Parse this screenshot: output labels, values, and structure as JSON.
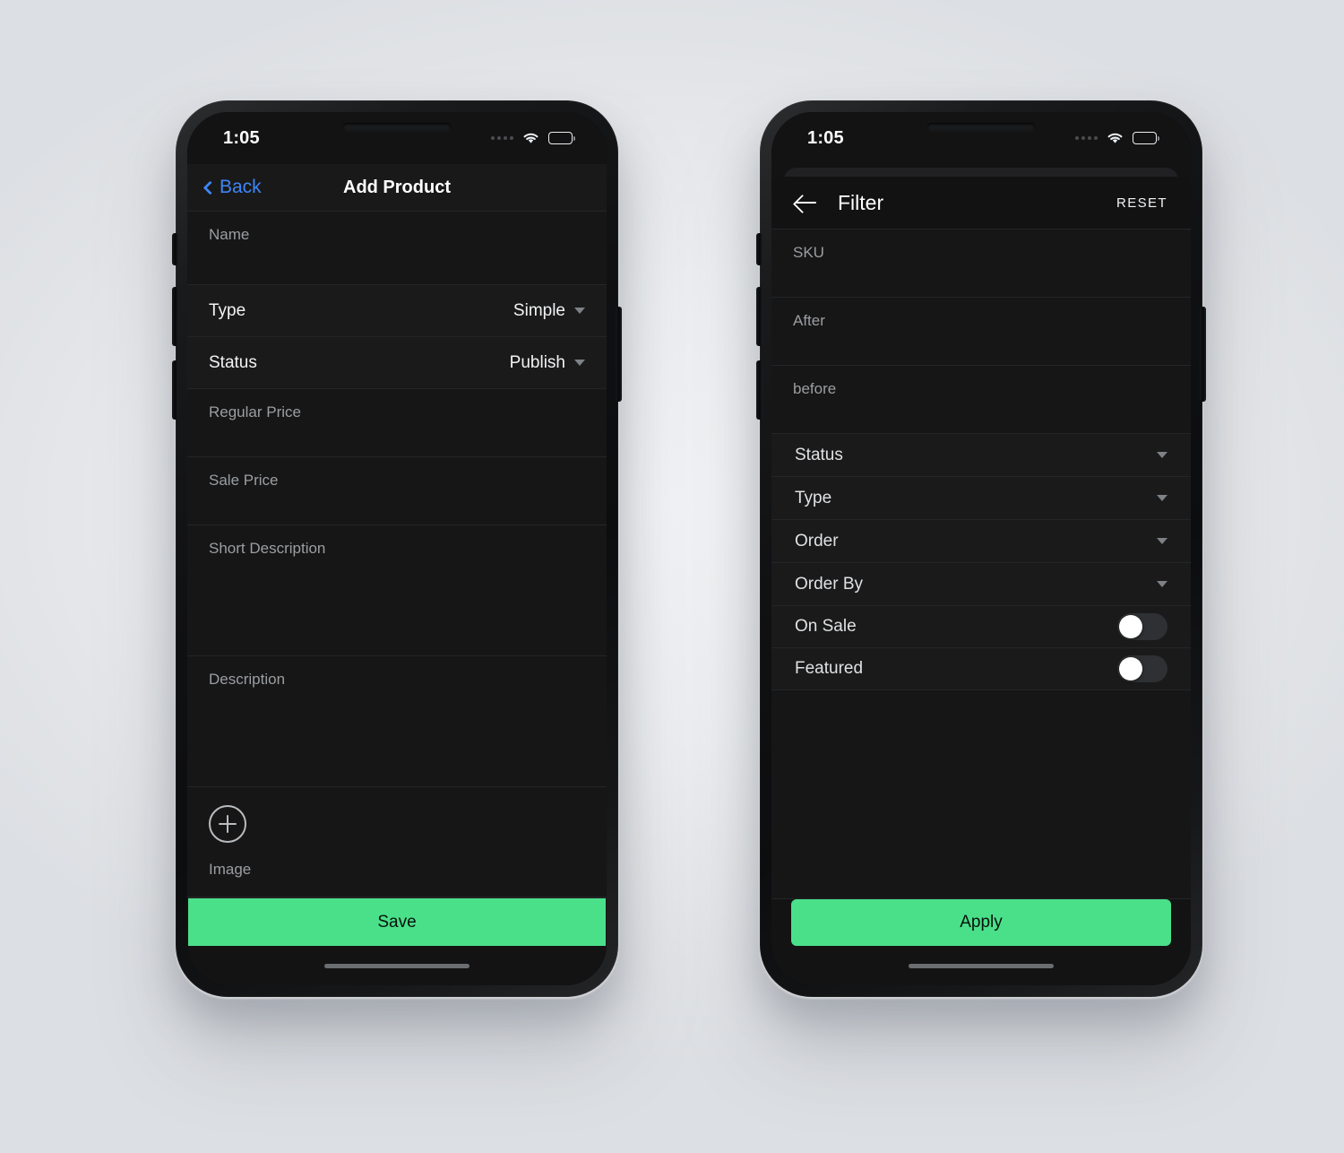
{
  "theme": {
    "accent_green": "#4ae08a",
    "ios_blue": "#3d87f5",
    "screen_bg": "#131314",
    "row_bg": "#1a1a1b",
    "divider": "#242527",
    "label_muted": "#9b9ea1",
    "page_bg": "#e8eaec"
  },
  "left_phone": {
    "status_bar": {
      "time": "1:05",
      "wifi_icon": "wifi-icon",
      "battery_icon": "battery-icon",
      "battery_level": 70,
      "signal_icon": "signal-dots-icon"
    },
    "nav": {
      "back_label": "Back",
      "back_icon": "chevron-left-icon",
      "title": "Add Product"
    },
    "fields": [
      {
        "label": "Name",
        "value": "",
        "type": "text"
      },
      {
        "label": "Regular Price",
        "value": "",
        "type": "text"
      },
      {
        "label": "Sale Price",
        "value": "",
        "type": "text"
      },
      {
        "label": "Short Description",
        "value": "",
        "type": "textarea"
      },
      {
        "label": "Description",
        "value": "",
        "type": "textarea"
      }
    ],
    "selects": [
      {
        "label": "Type",
        "value": "Simple",
        "icon": "caret-down-icon"
      },
      {
        "label": "Status",
        "value": "Publish",
        "icon": "caret-down-icon"
      }
    ],
    "image_section": {
      "add_icon": "plus-circle-icon",
      "label": "Image"
    },
    "primary_button": {
      "label": "Save"
    }
  },
  "right_phone": {
    "status_bar": {
      "time": "1:05",
      "wifi_icon": "wifi-icon",
      "battery_icon": "battery-icon",
      "battery_level": 70,
      "signal_icon": "signal-dots-icon"
    },
    "nav": {
      "back_icon": "arrow-left-icon",
      "title": "Filter",
      "reset_label": "RESET"
    },
    "fields": [
      {
        "label": "SKU",
        "value": ""
      },
      {
        "label": "After",
        "value": ""
      },
      {
        "label": "before",
        "value": ""
      }
    ],
    "dropdowns": [
      {
        "label": "Status",
        "icon": "caret-down-icon"
      },
      {
        "label": "Type",
        "icon": "caret-down-icon"
      },
      {
        "label": "Order",
        "icon": "caret-down-icon"
      },
      {
        "label": "Order By",
        "icon": "caret-down-icon"
      }
    ],
    "toggles": [
      {
        "label": "On Sale",
        "on": false
      },
      {
        "label": "Featured",
        "on": false
      }
    ],
    "primary_button": {
      "label": "Apply"
    }
  }
}
